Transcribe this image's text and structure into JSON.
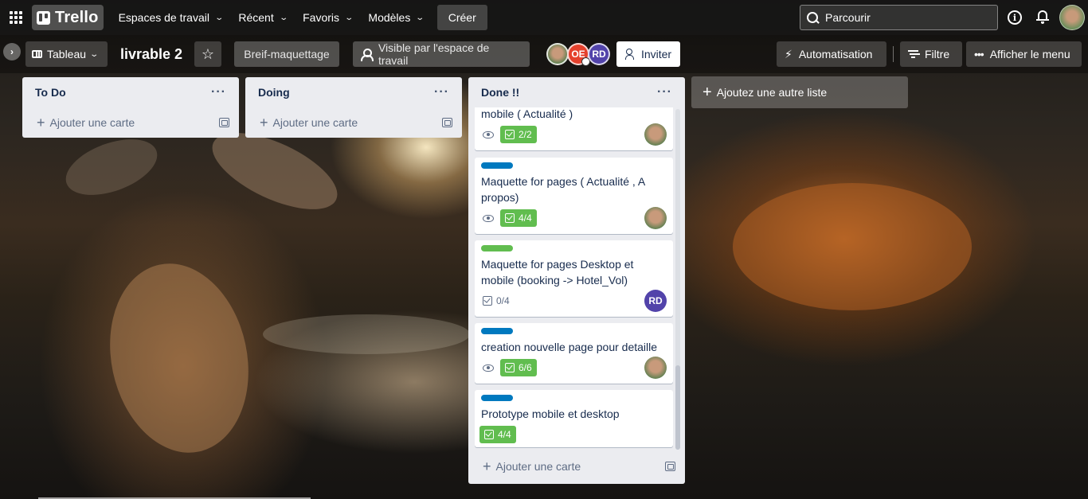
{
  "topbar": {
    "logo": "Trello",
    "nav": [
      {
        "label": "Espaces de travail"
      },
      {
        "label": "Récent"
      },
      {
        "label": "Favoris"
      },
      {
        "label": "Modèles"
      }
    ],
    "create_label": "Créer",
    "search_placeholder": "Parcourir"
  },
  "board": {
    "view_label": "Tableau",
    "title": "livrable 2",
    "workspace_label": "Breif-maquettage",
    "visibility_label": "Visible par l'espace de travail",
    "members": [
      "OE",
      "RD"
    ],
    "invite_label": "Inviter",
    "automation_label": "Automatisation",
    "filter_label": "Filtre",
    "menu_label": "Afficher le menu"
  },
  "lists": [
    {
      "title": "To Do",
      "add_card": "Ajouter une carte"
    },
    {
      "title": "Doing",
      "add_card": "Ajouter une carte"
    },
    {
      "title": "Done !!",
      "add_card": "Ajouter une carte",
      "cards": [
        {
          "title": "mobile ( Actualité )",
          "label_color": "",
          "checklist": "2/2",
          "complete": true,
          "watch": true,
          "member": "avatar"
        },
        {
          "title": "Maquette for pages ( Actualité , A propos)",
          "label_color": "#0079bf",
          "checklist": "4/4",
          "complete": true,
          "watch": true,
          "member": "avatar"
        },
        {
          "title": "Maquette for pages Desktop et mobile (booking -> Hotel_Vol)",
          "label_color": "#61bd4f",
          "checklist": "0/4",
          "complete": false,
          "watch": false,
          "member": "RD"
        },
        {
          "title": "creation nouvelle page pour detaille",
          "label_color": "#0079bf",
          "checklist": "6/6",
          "complete": true,
          "watch": true,
          "member": "avatar"
        },
        {
          "title": "Prototype mobile et desktop",
          "label_color": "#0079bf",
          "checklist": "4/4",
          "complete": true,
          "watch": false,
          "member": ""
        }
      ]
    }
  ],
  "add_list_label": "Ajoutez une autre liste",
  "colors": {
    "label_blue": "#0079bf",
    "label_green": "#61bd4f",
    "badge_green": "#61bd4f",
    "member_purple": "#5243aa",
    "member_red": "#e5412d"
  }
}
